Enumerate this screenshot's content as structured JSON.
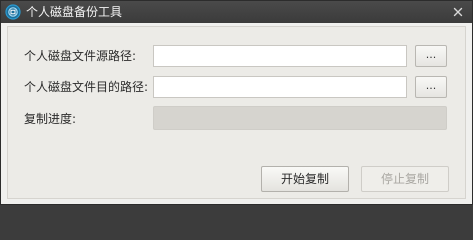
{
  "window": {
    "title": "个人磁盘备份工具"
  },
  "form": {
    "source_label": "个人磁盘文件源路径:",
    "source_value": "",
    "source_browse": "...",
    "dest_label": "个人磁盘文件目的路径:",
    "dest_value": "",
    "dest_browse": "...",
    "progress_label": "复制进度:",
    "progress_value": 0
  },
  "actions": {
    "start_label": "开始复制",
    "stop_label": "停止复制"
  },
  "colors": {
    "titlebar": "#3f3f3f",
    "icon_accent": "#2a9bd1",
    "background": "#ecebe7"
  }
}
